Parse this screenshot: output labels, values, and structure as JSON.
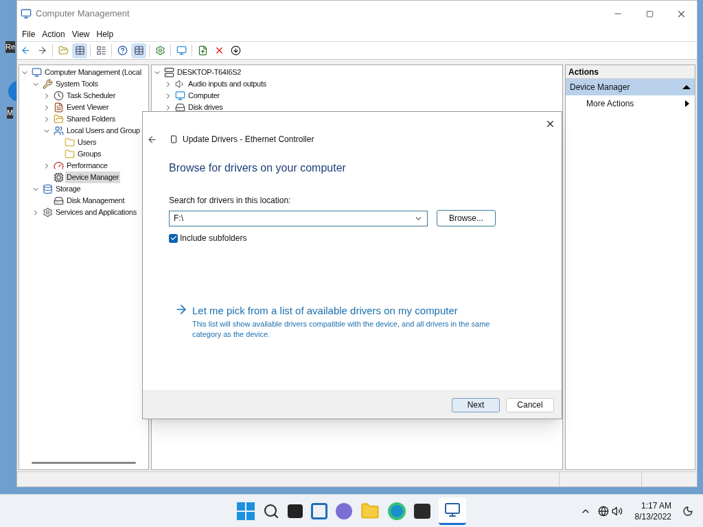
{
  "desktop_icons": [
    {
      "label": "Re"
    },
    {
      "label": "M"
    }
  ],
  "window": {
    "title": "Computer Management"
  },
  "menu": [
    "File",
    "Action",
    "View",
    "Help"
  ],
  "tree": [
    {
      "label": "Computer Management (Local",
      "kind": "computer",
      "selected": false,
      "expanded": true,
      "children": [
        {
          "label": "System Tools",
          "kind": "tools",
          "selected": false,
          "expanded": true,
          "children": [
            {
              "label": "Task Scheduler",
              "kind": "clock",
              "selected": false,
              "expanded": false
            },
            {
              "label": "Event Viewer",
              "kind": "log",
              "selected": false,
              "expanded": false
            },
            {
              "label": "Shared Folders",
              "kind": "share",
              "selected": false,
              "expanded": false
            },
            {
              "label": "Local Users and Group",
              "kind": "users",
              "selected": false,
              "expanded": true,
              "children": [
                {
                  "label": "Users",
                  "kind": "folder",
                  "selected": false
                },
                {
                  "label": "Groups",
                  "kind": "folder",
                  "selected": false
                }
              ]
            },
            {
              "label": "Performance",
              "kind": "gauge",
              "selected": false,
              "expanded": false
            },
            {
              "label": "Device Manager",
              "kind": "device",
              "selected": true
            }
          ]
        },
        {
          "label": "Storage",
          "kind": "storage",
          "selected": false,
          "expanded": true,
          "children": [
            {
              "label": "Disk Management",
              "kind": "disk",
              "selected": false
            }
          ]
        },
        {
          "label": "Services and Applications",
          "kind": "services",
          "selected": false,
          "expanded": false
        }
      ]
    }
  ],
  "devices": [
    {
      "label": "DESKTOP-T64I6S2",
      "kind": "pc",
      "selected": false,
      "expanded": true,
      "children": [
        {
          "label": "Audio inputs and outputs",
          "kind": "speaker",
          "selected": false,
          "expanded": false
        },
        {
          "label": "Computer",
          "kind": "monitor",
          "selected": false,
          "expanded": false
        },
        {
          "label": "Disk drives",
          "kind": "disk",
          "selected": false,
          "expanded": false
        }
      ]
    }
  ],
  "actions": {
    "header": "Actions",
    "section": {
      "label": "Device Manager",
      "expanded": true
    },
    "items": [
      {
        "label": "More Actions"
      }
    ]
  },
  "dialog": {
    "title": "Update Drivers - Ethernet Controller",
    "heading": "Browse for drivers on your computer",
    "field_label": "Search for drivers in this location:",
    "path": "F:\\",
    "browse": "Browse...",
    "checkbox": {
      "label": "Include subfolders",
      "checked": true
    },
    "link": {
      "title": "Let me pick from a list of available drivers on my computer",
      "description": "This list will show available drivers compatible with the device, and all drivers in the same category as the device."
    },
    "buttons": [
      {
        "label": "Next",
        "primary": true
      },
      {
        "label": "Cancel",
        "primary": false
      }
    ]
  },
  "taskbar": {
    "time": "1:17 AM",
    "date": "8/13/2022"
  }
}
